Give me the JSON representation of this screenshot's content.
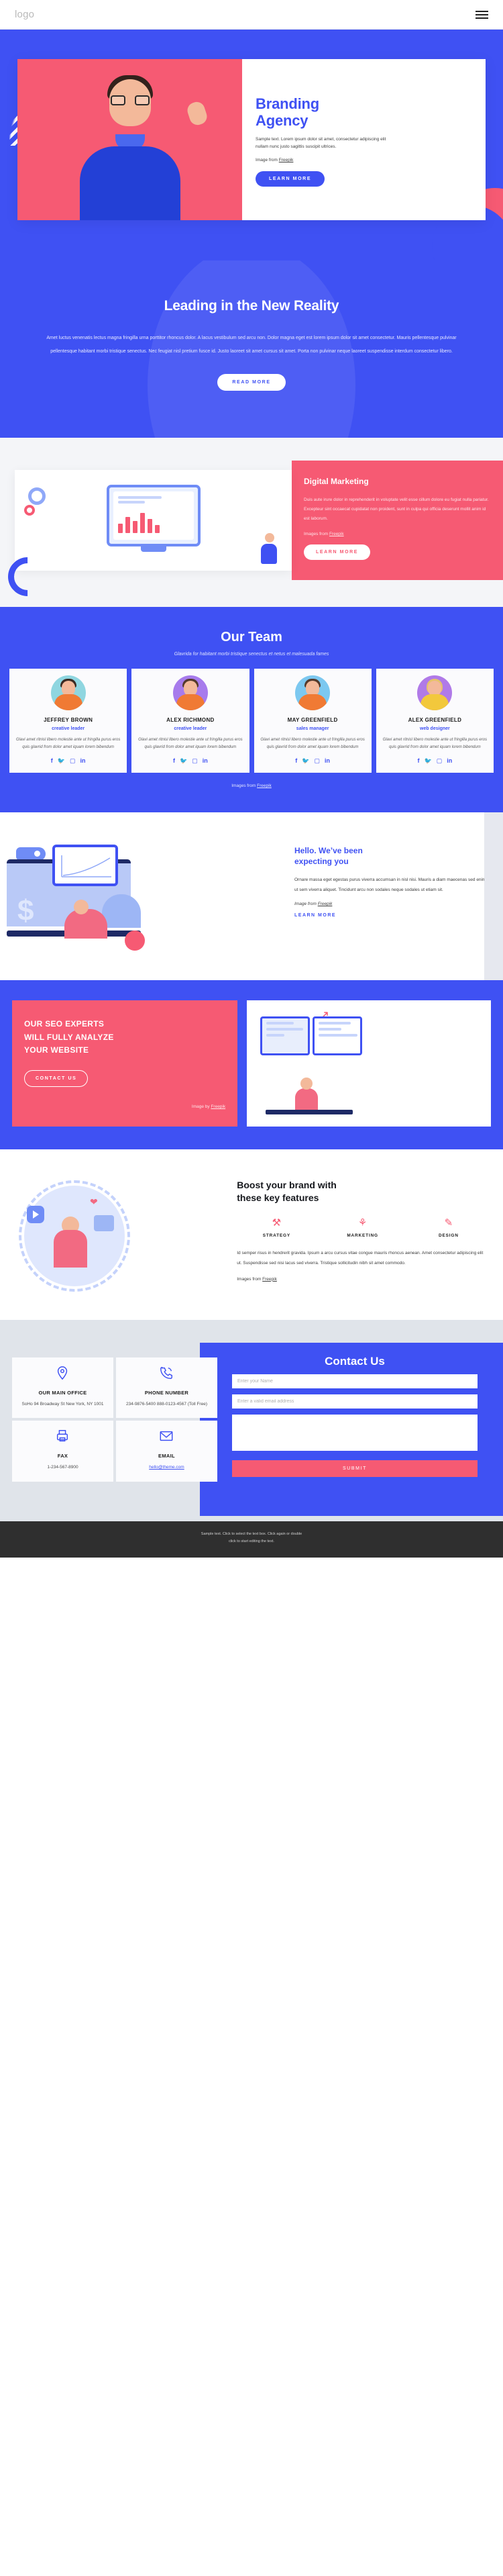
{
  "header": {
    "logo": "logo",
    "menu_icon": "hamburger-icon"
  },
  "hero": {
    "title_line1": "Branding",
    "title_line2": "Agency",
    "subtitle": "Sample text. Lorem ipsum dolor sit amet, consectetur adipiscing elit nullam nunc justo sagittis suscipit ultrices.",
    "credit_prefix": "Image from ",
    "credit_link": "Freepik",
    "cta": "LEARN MORE"
  },
  "reality": {
    "title": "Leading in the New Reality",
    "body": "Amet luctus venenatis lectus magna fringilla urna porttitor rhoncus dolor. A lacus vestibulum sed arcu non. Dolor magna eget est lorem ipsum dolor sit amet consectetur. Mauris pellentesque pulvinar pellentesque habitant morbi tristique senectus. Nec feugiat nisl pretium fusce id. Justo laoreet sit amet cursus sit amet. Porta non pulvinar neque laoreet suspendisse interdum consectetur libero.",
    "cta": "READ MORE"
  },
  "digital_marketing": {
    "title": "Digital Marketing",
    "body": "Duis aute irure dolor in reprehenderit in voluptate velit esse cillum dolore eu fugiat nulla pariatur. Excepteur sint occaecat cupidatat non proident, sunt in culpa qui officia deserunt mollit anim id est laborum.",
    "credit_prefix": "Images from ",
    "credit_link": "Freepik",
    "cta": "LEARN MORE"
  },
  "team": {
    "title": "Our Team",
    "subtitle": "Glavrida for habitant morbi tristique senectus et netus et malesuada fames",
    "credit_prefix": "Images from ",
    "credit_link": "Freepik",
    "members": [
      {
        "name": "JEFFREY BROWN",
        "role": "creative leader",
        "bio": "Glavi amet ritnisl libero molestie ante ut fringilla purus eros quis glavrid from dolor amet iquam lorem bibendum"
      },
      {
        "name": "ALEX RICHMOND",
        "role": "creative leader",
        "bio": "Glavi amet ritnisl libero molestie ante ut fringilla purus eros quis glavrid from dolor amet iquam lorem bibendum"
      },
      {
        "name": "MAY GREENFIELD",
        "role": "sales manager",
        "bio": "Glavi amet ritnisl libero molestie ante ut fringilla purus eros quis glavrid from dolor amet iquam lorem bibendum"
      },
      {
        "name": "ALEX GREENFIELD",
        "role": "web designer",
        "bio": "Glavi amet ritnisl libero molestie ante ut fringilla purus eros quis glavrid from dolor amet iquam lorem bibendum"
      }
    ],
    "social": [
      "facebook-icon",
      "twitter-icon",
      "instagram-icon",
      "linkedin-icon"
    ]
  },
  "hello": {
    "title_line1": "Hello. We’ve been",
    "title_line2": "expecting you",
    "body": "Ornare massa eget egestas purus viverra accumsan in nisl nisi. Mauris a diam maecenas sed enim ut sem viverra aliquet. Tincidunt arcu non sodales neque sodales ut etiam sit.",
    "credit_prefix": "Image from ",
    "credit_link": "Freepik",
    "cta": "LEARN MORE"
  },
  "seo": {
    "title_line1": "OUR SEO EXPERTS",
    "title_line2": "WILL FULLY ANALYZE",
    "title_line3": "YOUR WEBSITE",
    "cta": "CONTACT US",
    "credit_prefix": "Image by ",
    "credit_link": "Freepik"
  },
  "features": {
    "title_line1": "Boost your brand with",
    "title_line2": "these key features",
    "items": [
      {
        "icon": "strategy-icon",
        "glyph": "⚒",
        "label": "STRATEGY"
      },
      {
        "icon": "marketing-icon",
        "glyph": "⚘",
        "label": "MARKETING"
      },
      {
        "icon": "design-icon",
        "glyph": "✎",
        "label": "DESIGN"
      }
    ],
    "body": "Id semper risus in hendrerit gravida. Ipsum a arcu cursus vitae congue mauris rhoncus aenean. Amet consectetur adipiscing elit ut. Suspendisse sed nisi lacus sed viverra. Tristique sollicitudin nibh sit amet commodo.",
    "credit_prefix": "Images from ",
    "credit_link": "Freepik"
  },
  "contact": {
    "title": "Contact Us",
    "cards": [
      {
        "icon": "location-pin-icon",
        "title": "OUR MAIN OFFICE",
        "value": "SoHo 94 Broadway St New York, NY 1001",
        "link": null
      },
      {
        "icon": "phone-icon",
        "title": "PHONE NUMBER",
        "value": "234-9876-5400 888-0123-4567 (Toll Free)",
        "link": null
      },
      {
        "icon": "fax-printer-icon",
        "title": "FAX",
        "value": "1-234-567-8900",
        "link": null
      },
      {
        "icon": "email-envelope-icon",
        "title": "EMAIL",
        "value": "",
        "link": "hello@theme.com"
      }
    ],
    "form": {
      "name_placeholder": "Enter your Name",
      "email_placeholder": "Enter a valid email address",
      "message_placeholder": "",
      "submit": "SUBMIT"
    }
  },
  "footer": {
    "text_before": "Sample text. Click to select the text box. Click again or double ",
    "text_after": "click to start editing the text."
  },
  "colors": {
    "blue": "#3f51f3",
    "pink": "#f65a73",
    "grey": "#e0e4ea",
    "dark": "#2f2f2f"
  }
}
